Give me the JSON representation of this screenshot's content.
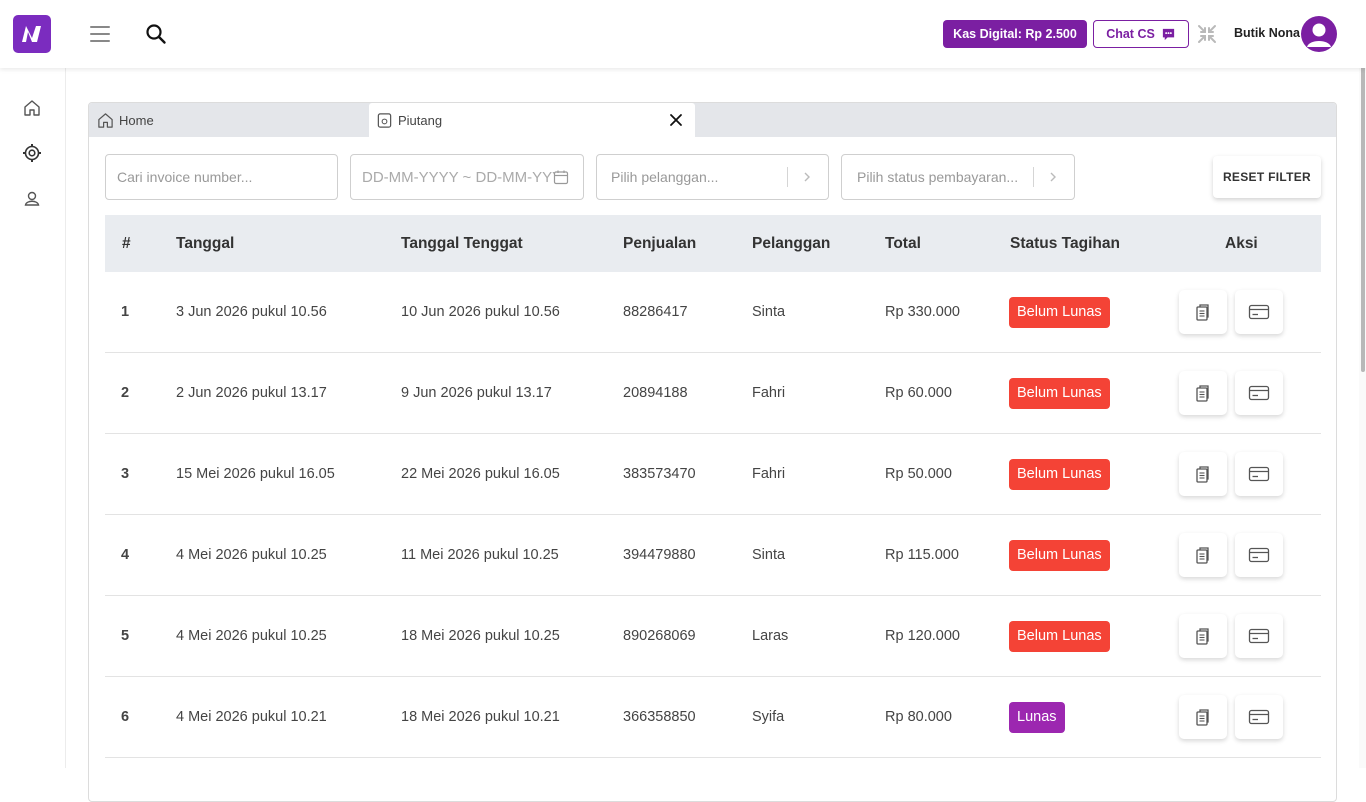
{
  "header": {
    "kas_label": "Kas Digital: Rp 2.500",
    "chat_label": "Chat CS",
    "user_name": "Butik Nona"
  },
  "tabs": [
    {
      "label": "Home"
    },
    {
      "label": "Piutang"
    }
  ],
  "filters": {
    "invoice_placeholder": "Cari invoice number...",
    "date_placeholder": "DD-MM-YYYY ~ DD-MM-YYYY",
    "pelanggan_placeholder": "Pilih pelanggan...",
    "status_placeholder": "Pilih status pembayaran...",
    "reset_label": "RESET FILTER"
  },
  "table": {
    "columns": [
      "#",
      "Tanggal",
      "Tanggal Tenggat",
      "Penjualan",
      "Pelanggan",
      "Total",
      "Status Tagihan",
      "Aksi"
    ],
    "rows": [
      {
        "no": "1",
        "tanggal": "3 Jun 2026 pukul 10.56",
        "tenggat": "10 Jun 2026 pukul 10.56",
        "penjualan": "88286417",
        "pelanggan": "Sinta",
        "total": "Rp 330.000",
        "status": "Belum Lunas"
      },
      {
        "no": "2",
        "tanggal": "2 Jun 2026 pukul 13.17",
        "tenggat": "9 Jun 2026 pukul 13.17",
        "penjualan": "20894188",
        "pelanggan": "Fahri",
        "total": "Rp 60.000",
        "status": "Belum Lunas"
      },
      {
        "no": "3",
        "tanggal": "15 Mei 2026 pukul 16.05",
        "tenggat": "22 Mei 2026 pukul 16.05",
        "penjualan": "383573470",
        "pelanggan": "Fahri",
        "total": "Rp 50.000",
        "status": "Belum Lunas"
      },
      {
        "no": "4",
        "tanggal": "4 Mei 2026 pukul 10.25",
        "tenggat": "11 Mei 2026 pukul 10.25",
        "penjualan": "394479880",
        "pelanggan": "Sinta",
        "total": "Rp 115.000",
        "status": "Belum Lunas"
      },
      {
        "no": "5",
        "tanggal": "4 Mei 2026 pukul 10.25",
        "tenggat": "18 Mei 2026 pukul 10.25",
        "penjualan": "890268069",
        "pelanggan": "Laras",
        "total": "Rp 120.000",
        "status": "Belum Lunas"
      },
      {
        "no": "6",
        "tanggal": "4 Mei 2026 pukul 10.21",
        "tenggat": "18 Mei 2026 pukul 10.21",
        "penjualan": "366358850",
        "pelanggan": "Syifa",
        "total": "Rp 80.000",
        "status": "Lunas"
      }
    ]
  },
  "colors": {
    "brand": "#7b1fa2",
    "unpaid": "#f44336",
    "paid": "#9c27b0"
  },
  "icons": {
    "row_action_1": "clipboard-icon",
    "row_action_2": "card-icon"
  }
}
